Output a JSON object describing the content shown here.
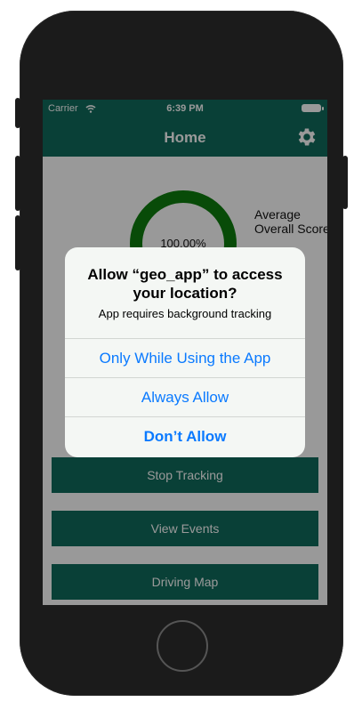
{
  "status_bar": {
    "carrier": "Carrier",
    "time": "6:39 PM"
  },
  "nav": {
    "title": "Home",
    "settings_icon": "gear-icon"
  },
  "score": {
    "percent": "100.00%",
    "label_line1": "Average",
    "label_line2": "Overall Score",
    "level": 1.0,
    "ring_color": "#0e7e0e"
  },
  "buttons": {
    "stop_tracking": "Stop Tracking",
    "view_events": "View Events",
    "driving_map": "Driving Map"
  },
  "alert": {
    "title": "Allow “geo_app” to access your location?",
    "message": "App requires background tracking",
    "option_while_using": "Only While Using the App",
    "option_always": "Always Allow",
    "option_deny": "Don’t Allow"
  },
  "colors": {
    "primary": "#0f6b5c",
    "alert_blue": "#0a7aff"
  }
}
